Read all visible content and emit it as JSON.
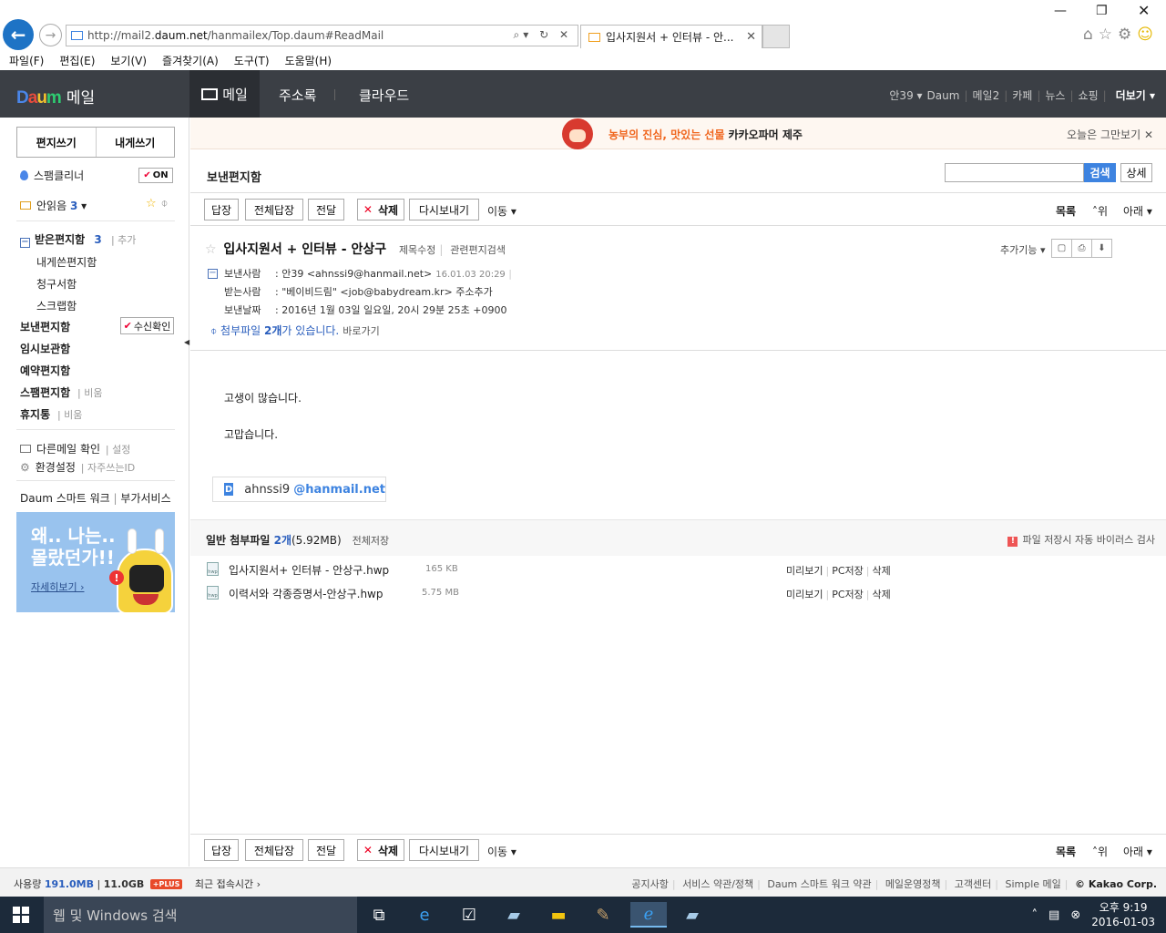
{
  "browser": {
    "url_prefix": "http://mail2.",
    "url_domain": "daum.net",
    "url_suffix": "/hanmailex/Top.daum#ReadMail",
    "tab_title": "입사지원서 + 인터뷰 - 안...",
    "menu": [
      "파일(F)",
      "편집(E)",
      "보기(V)",
      "즐겨찾기(A)",
      "도구(T)",
      "도움말(H)"
    ]
  },
  "daum_header": {
    "logo_text": "Daum",
    "service_name": "메일",
    "nav": {
      "mail": "메일",
      "contacts": "주소록",
      "cloud": "클라우드"
    },
    "util": {
      "user": "안39",
      "daum": "Daum",
      "mail2": "메일2",
      "cafe": "카페",
      "news": "뉴스",
      "shopping": "쇼핑",
      "more": "더보기"
    }
  },
  "sidebar": {
    "write_label": "편지쓰기",
    "self_write_label": "내게쓰기",
    "spam_cleaner_label": "스팸클리너",
    "spam_toggle": "ON",
    "unread_label": "안읽음",
    "unread_count": "3",
    "inbox_label": "받은편지함",
    "inbox_count": "3",
    "inbox_add": "추가",
    "sub_folders": [
      "내게쓴편지함",
      "청구서함",
      "스크랩함"
    ],
    "sent_label": "보낸편지함",
    "receipt_label": "수신확인",
    "drafts_label": "임시보관함",
    "scheduled_label": "예약편지함",
    "spam_label": "스팸편지함",
    "spam_empty": "비움",
    "trash_label": "휴지통",
    "trash_empty": "비움",
    "other_mail_label": "다른메일 확인",
    "other_mail_setting": "설정",
    "settings_label": "환경설정",
    "frequent_id": "자주쓰는ID",
    "smart_work": "Daum 스마트 워크",
    "extra_service": "부가서비스",
    "banner": {
      "line1": "왜.. 나는..",
      "line2": "몰랐던가!!",
      "more": "자세히보기 ›"
    }
  },
  "promo": {
    "orange_text": "농부의 진심, 맛있는 선물",
    "dark_text": "카카오파머 제주",
    "dismiss": "오늘은 그만보기"
  },
  "main": {
    "folder_title": "보낸편지함",
    "search_button": "검색",
    "detail_button": "상세",
    "toolbar": {
      "reply": "답장",
      "reply_all": "전체답장",
      "forward": "전달",
      "delete": "삭제",
      "resend": "다시보내기",
      "move": "이동",
      "list": "목록",
      "up": "위",
      "down": "아래"
    },
    "subject": "입사지원서 + 인터뷰 - 안상구",
    "edit_subject": "제목수정",
    "related_search": "관련편지검색",
    "extra_func": "추가기능",
    "from_label": "보낸사람",
    "from_value": "안39 <ahnssi9@hanmail.net>",
    "from_date": "16.01.03 20:29",
    "to_label": "받는사람",
    "to_value": "\"베이비드림\" <job@babydream.kr>",
    "to_add": "주소추가",
    "sent_date_label": "보낸날짜",
    "sent_date_value": "2016년 1월 03일 일요일, 20시 29분 25초 +0900",
    "attach_prefix": "첨부파일",
    "attach_count": "2개",
    "attach_suffix": "가 있습니다.",
    "attach_go": "바로가기",
    "body_lines": [
      "고생이 많습니다.",
      "고맙습니다."
    ],
    "signature_user": "ahnssi9",
    "signature_domain": "@hanmail.net"
  },
  "attachments": {
    "title": "일반 첨부파일",
    "count": "2개",
    "size": "(5.92MB)",
    "save_all": "전체저장",
    "virus_note": "파일 저장시 자동 바이러스 검사",
    "files": [
      {
        "name": "입사지원서+ 인터뷰 - 안상구.hwp",
        "size": "165 KB"
      },
      {
        "name": "이력서와 각종증명서-안상구.hwp",
        "size": "5.75 MB"
      }
    ],
    "actions": {
      "preview": "미리보기",
      "pc_save": "PC저장",
      "delete": "삭제"
    }
  },
  "footer": {
    "usage_label": "사용량",
    "usage_used": "191.0MB",
    "usage_total": "11.0GB",
    "plus": "+PLUS",
    "recent_access": "최근 접속시간 ›",
    "links": [
      "공지사항",
      "서비스 약관/정책",
      "Daum 스마트 워크 약관",
      "메일운영정책",
      "고객센터",
      "Simple 메일"
    ],
    "corp": "© Kakao Corp."
  },
  "taskbar": {
    "search_placeholder": "웹 및 Windows 검색",
    "time": "오후 9:19",
    "date": "2016-01-03"
  },
  "colors": {
    "daum_header_bg": "#3b3f45",
    "search_blue": "#3d83e0",
    "link_blue": "#2a5ebd",
    "promo_orange": "#f0661e"
  }
}
